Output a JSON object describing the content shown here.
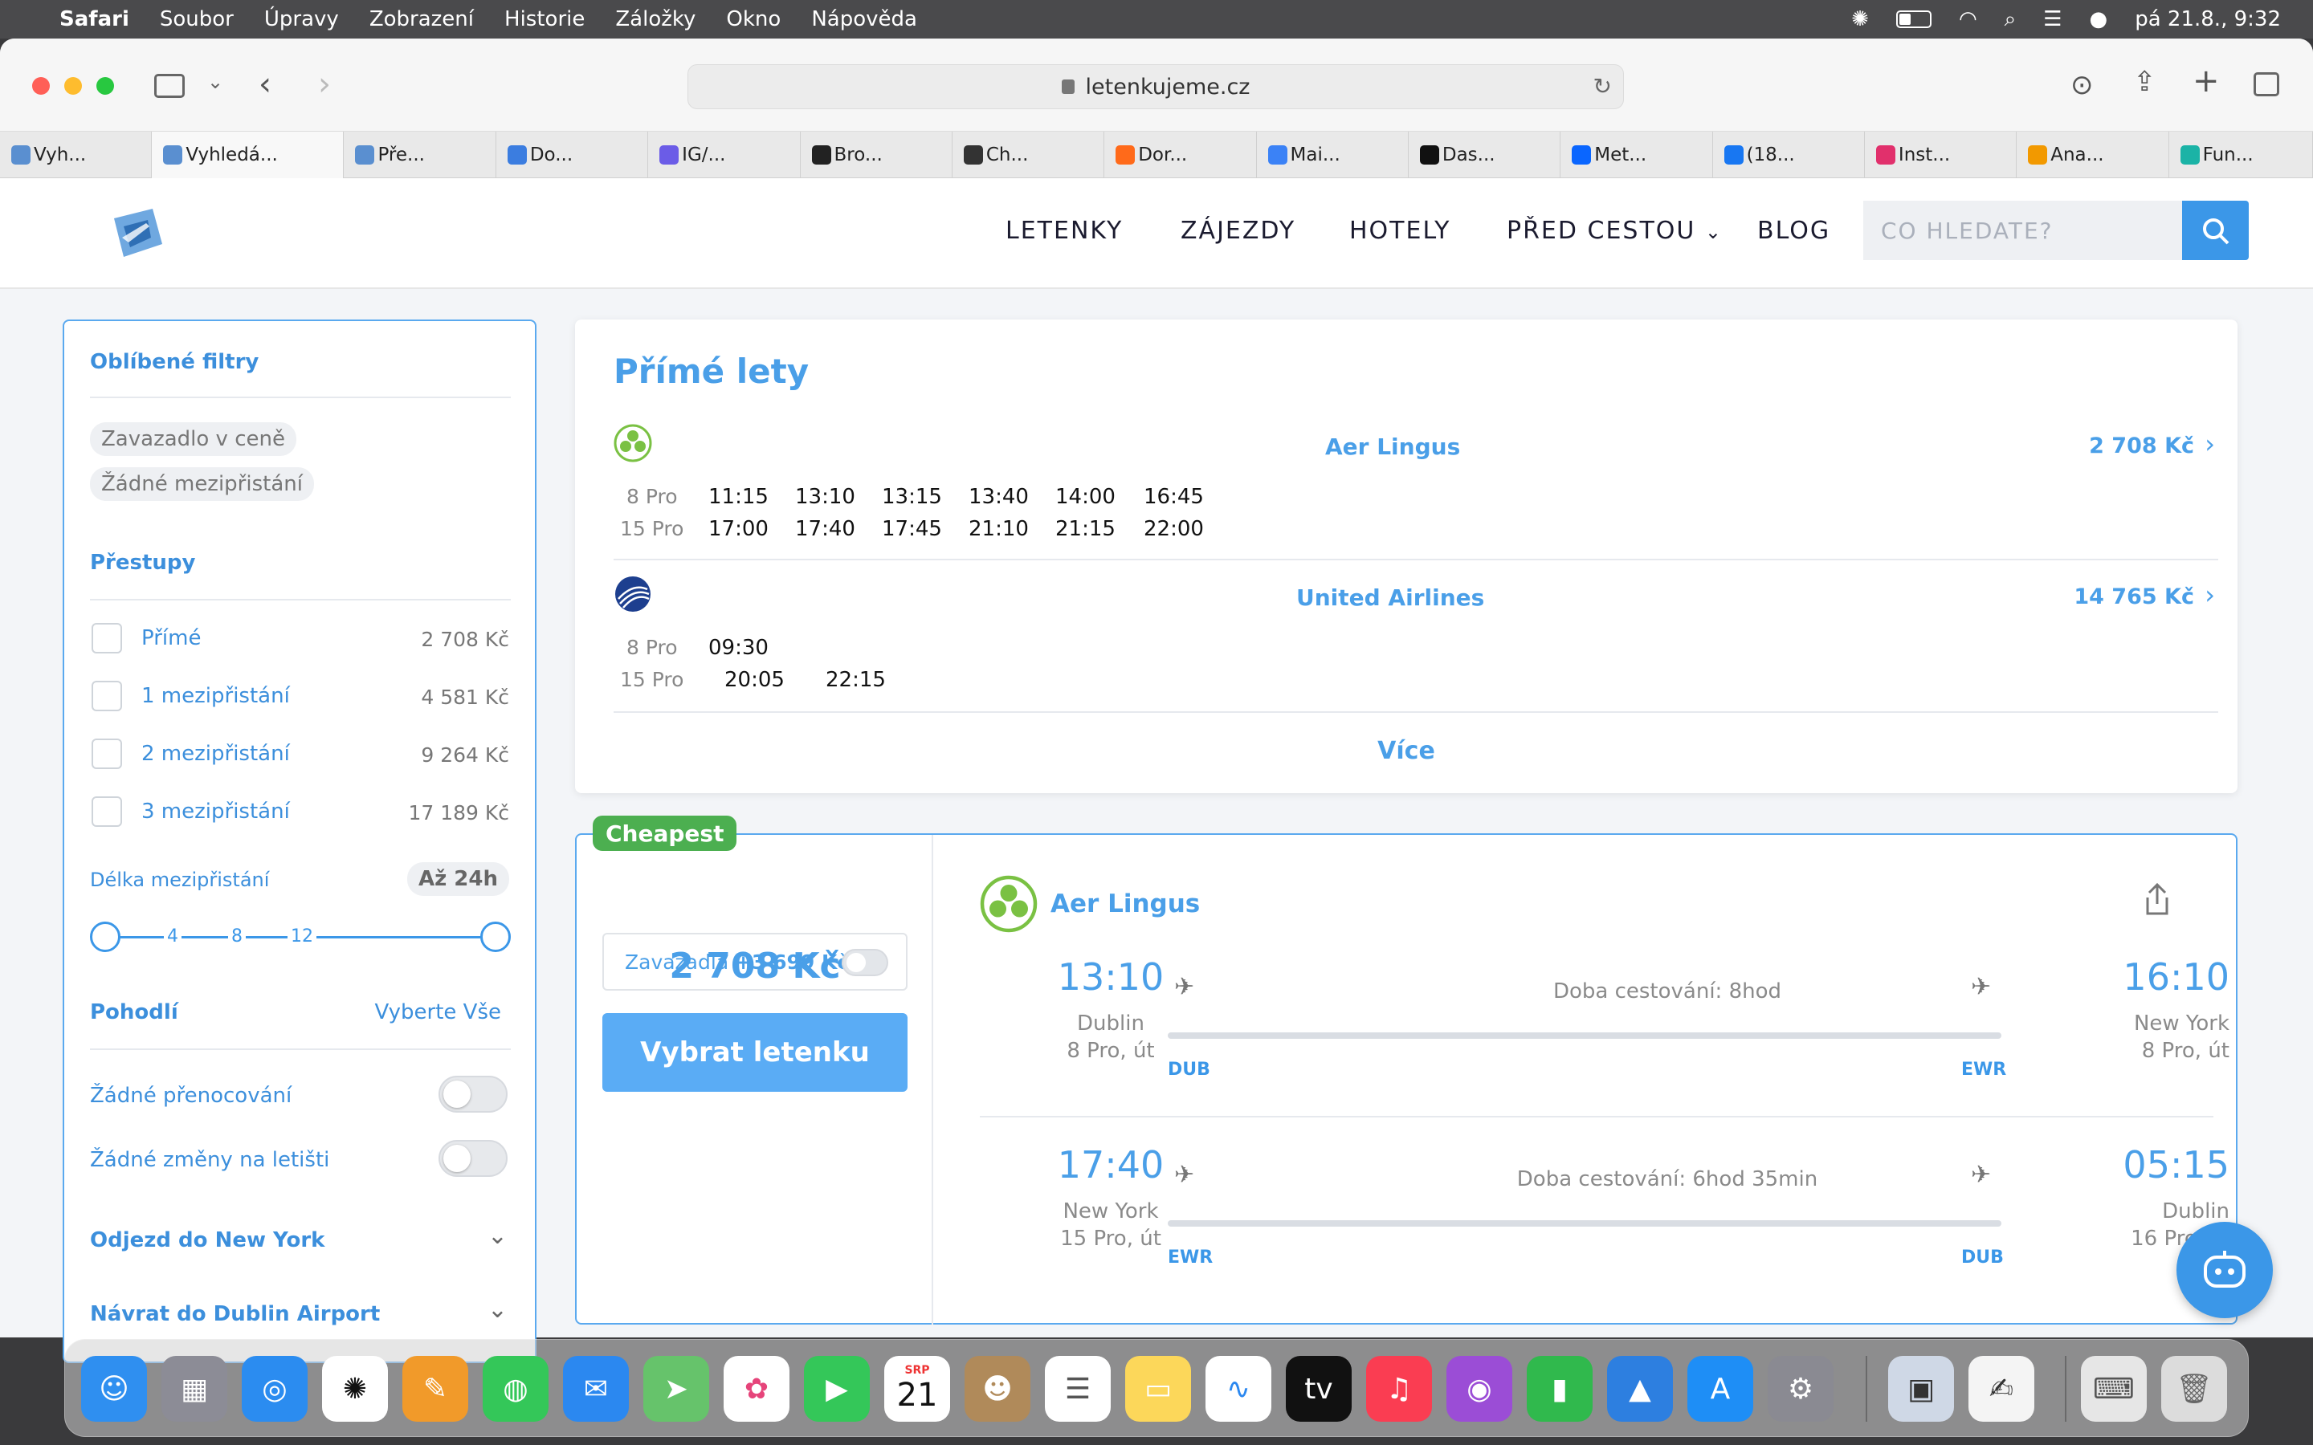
{
  "menubar": {
    "items": [
      "Safari",
      "Soubor",
      "Úpravy",
      "Zobrazení",
      "Historie",
      "Záložky",
      "Okno",
      "Nápověda"
    ],
    "clock": "pá 21.8., 9:32"
  },
  "browser": {
    "url": "letenkujeme.cz",
    "tabs": [
      {
        "label": "Vyh...",
        "color": "#5a8fd0"
      },
      {
        "label": "Vyhledá...",
        "color": "#5a8fd0"
      },
      {
        "label": "Pře...",
        "color": "#5a8fd0"
      },
      {
        "label": "Do...",
        "color": "#3b7de0"
      },
      {
        "label": "IG/...",
        "color": "#6b5ce7"
      },
      {
        "label": "Bro...",
        "color": "#222222"
      },
      {
        "label": "Ch...",
        "color": "#333333"
      },
      {
        "label": "Dor...",
        "color": "#ff6a1a"
      },
      {
        "label": "Mai...",
        "color": "#3b82f6"
      },
      {
        "label": "Das...",
        "color": "#111111"
      },
      {
        "label": "Met...",
        "color": "#0a66ff"
      },
      {
        "label": "(18...",
        "color": "#1877f2"
      },
      {
        "label": "Inst...",
        "color": "#e1306c"
      },
      {
        "label": "Ana...",
        "color": "#f29900"
      },
      {
        "label": "Fun...",
        "color": "#1bb3a6"
      }
    ]
  },
  "site": {
    "nav": [
      "LETENKY",
      "ZÁJEZDY",
      "HOTELY",
      "PŘED CESTOU",
      "BLOG"
    ],
    "search_placeholder": "CO HLEDATE?"
  },
  "sidebar": {
    "fav_title": "Oblíbené filtry",
    "chips": [
      "Zavazadlo v ceně",
      "Žádné mezipřistání"
    ],
    "transfers_title": "Přestupy",
    "transfers": [
      {
        "label": "Přímé",
        "price": "2 708 Kč"
      },
      {
        "label": "1 mezipřistání",
        "price": "4 581 Kč"
      },
      {
        "label": "2 mezipřistání",
        "price": "9 264 Kč"
      },
      {
        "label": "3 mezipřistání",
        "price": "17 189 Kč"
      }
    ],
    "layover_title": "Délka mezipřistání",
    "layover_value": "Až 24h",
    "slider_ticks": [
      "4",
      "8",
      "12"
    ],
    "comfort_title": "Pohodlí",
    "select_all": "Vyberte Vše",
    "comfort_opts": [
      "Žádné přenocování",
      "Žádné změny na letišti"
    ],
    "depart_title": "Odjezd do New York",
    "return_title": "Návrat do Dublin Airport"
  },
  "direct": {
    "title": "Přímé lety",
    "more": "Více",
    "airlines": [
      {
        "name": "Aer Lingus",
        "price": "2 708 Kč",
        "out_date": "8 Pro",
        "out_times": [
          "11:15",
          "13:10",
          "13:15",
          "13:40",
          "14:00",
          "16:45"
        ],
        "ret_date": "15 Pro",
        "ret_times": [
          "17:00",
          "17:40",
          "17:45",
          "21:10",
          "21:15",
          "22:00"
        ]
      },
      {
        "name": "United Airlines",
        "price": "14 765 Kč",
        "out_date": "8 Pro",
        "out_times": [
          "09:30"
        ],
        "ret_date": "15 Pro",
        "ret_times": [
          "20:05",
          "22:15"
        ]
      }
    ]
  },
  "offer": {
    "badge": "Cheapest",
    "price": "2 708 Kč",
    "bags_label": "Zavazadla",
    "bags_price": "+3 699 Kč",
    "select_btn": "Vybrat letenku",
    "airline": "Aer Lingus",
    "legs": [
      {
        "dep_time": "13:10",
        "dep_city": "Dublin",
        "dep_date": "8 Pro, út",
        "duration": "Doba cestování: 8hod",
        "from": "DUB",
        "to": "EWR",
        "arr_time": "16:10",
        "arr_city": "New York",
        "arr_date": "8 Pro, út"
      },
      {
        "dep_time": "17:40",
        "dep_city": "New York",
        "dep_date": "15 Pro, út",
        "duration": "Doba cestování: 6hod 35min",
        "from": "EWR",
        "to": "DUB",
        "arr_time": "05:15",
        "arr_city": "Dublin",
        "arr_date": "16 Pro, st"
      }
    ]
  },
  "dock": {
    "calendar_month": "SRP",
    "calendar_day": "21",
    "apple_tv": "tv"
  }
}
